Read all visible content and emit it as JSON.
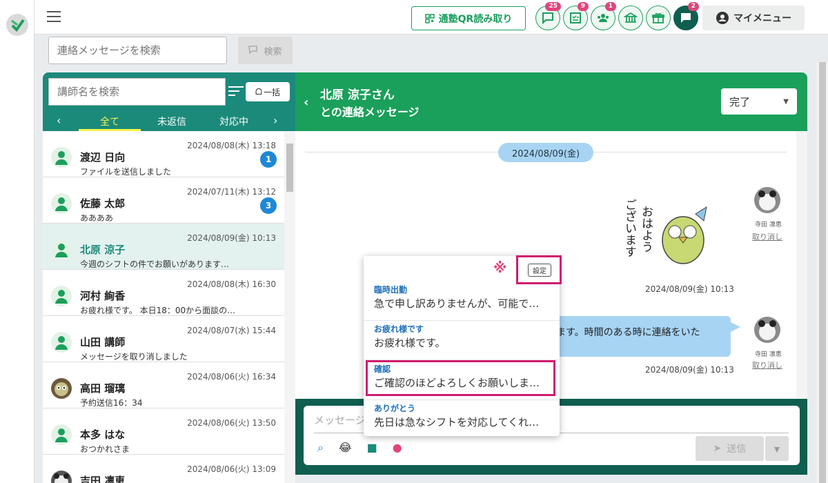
{
  "header": {
    "qr_button": "通塾QR読み取り",
    "icon_badges": [
      {
        "icon": "chat-icon",
        "count": "25"
      },
      {
        "icon": "checklist-icon",
        "count": "9"
      },
      {
        "icon": "group-icon",
        "count": "1"
      },
      {
        "icon": "school-icon",
        "count": ""
      },
      {
        "icon": "gift-icon",
        "count": ""
      },
      {
        "icon": "message-icon",
        "count": "2"
      }
    ],
    "my_menu": "マイメニュー"
  },
  "search": {
    "placeholder": "連絡メッセージを検索",
    "button": "検索"
  },
  "sidebar": {
    "teacher_search_placeholder": "講師名を検索",
    "bulk_button": "一括",
    "tabs": [
      "全て",
      "未返信",
      "対応中"
    ],
    "active_tab": "全て",
    "items": [
      {
        "name": "渡辺 日向",
        "date": "2024/08/08(木) 13:18",
        "message": "ファイルを送信しました",
        "unread": "1"
      },
      {
        "name": "佐藤 太郎",
        "date": "2024/07/11(木) 13:12",
        "message": "ああああ",
        "unread": "3"
      },
      {
        "name": "北原 涼子",
        "date": "2024/08/09(金) 10:13",
        "message": "今週のシフトの件でお願いがあります…",
        "unread": ""
      },
      {
        "name": "河村 絢香",
        "date": "2024/08/08(木) 16:30",
        "message": "お疲れ様です。 本日18：00から面談の…",
        "unread": ""
      },
      {
        "name": "山田 講師",
        "date": "2024/08/07(水) 15:44",
        "message": "メッセージを取り消しました",
        "unread": ""
      },
      {
        "name": "高田 瑠璃",
        "date": "2024/08/06(火) 16:34",
        "message": "予約送信16：34",
        "unread": ""
      },
      {
        "name": "本多 はな",
        "date": "2024/08/06(火) 13:50",
        "message": "おつかれさま",
        "unread": ""
      },
      {
        "name": "吉田 凛恵",
        "date": "2024/08/06(火) 13:09",
        "message": "",
        "unread": ""
      }
    ]
  },
  "chat": {
    "title_line1": "北原 涼子さん",
    "title_line2": "との連絡メッセージ",
    "status": "完了",
    "date_divider": "2024/08/09(金)",
    "sender_name": "寺田 凛恵",
    "cancel_label": "取り消し",
    "sticker_text": "おはよう ございます",
    "msg1_time": "2024/08/09(金) 10:13",
    "msg2_text": "ます。時間のある時に連絡をいた",
    "msg2_time": "2024/08/09(金) 10:13",
    "input_placeholder": "メッセージ",
    "send_label": "送信"
  },
  "template_popup": {
    "mark": "※",
    "settings_label": "設定",
    "items": [
      {
        "title": "臨時出勤",
        "text": "急で申し訳ありませんが、可能で…"
      },
      {
        "title": "お疲れ様です",
        "text": "お疲れ様です。"
      },
      {
        "title": "確認",
        "text": "ご確認のほどよろしくお願いしま…"
      },
      {
        "title": "ありがとう",
        "text": "先日は急なシフトを対応してくれ…"
      }
    ]
  },
  "colors": {
    "green": "#1aa05a",
    "teal": "#1b8a7a",
    "accent_pink": "#d01b6e",
    "bubble_blue": "#a8d4f4"
  }
}
